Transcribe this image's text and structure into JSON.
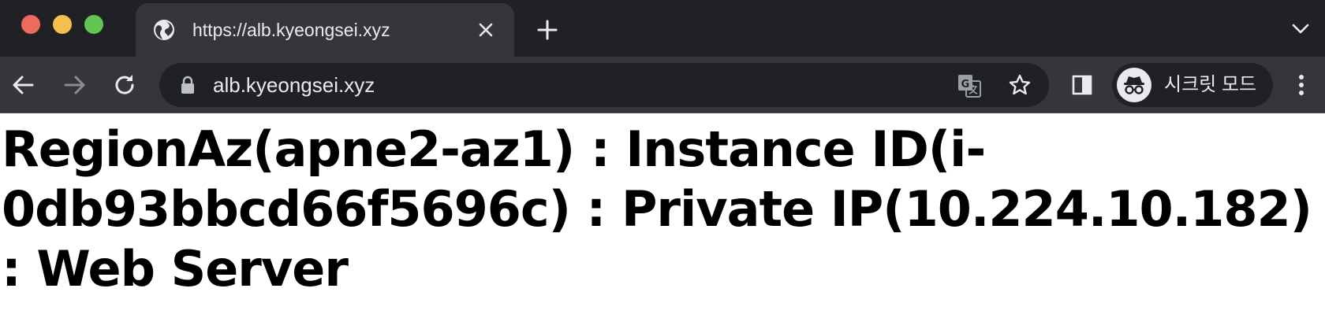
{
  "tab": {
    "title": "https://alb.kyeongsei.xyz",
    "favicon": "globe-icon"
  },
  "omnibox": {
    "url": "alb.kyeongsei.xyz"
  },
  "incognito": {
    "label": "시크릿 모드"
  },
  "page": {
    "heading": "RegionAz(apne2-az1) : Instance ID(i-0db93bbcd66f5696c) : Private IP(10.224.10.182) : Web Server"
  },
  "colors": {
    "chrome_dark": "#202124",
    "chrome_toolbar": "#35363a",
    "text_light": "#e8eaed",
    "close_red": "#ed6a5e",
    "minimize_yellow": "#f5bf4f",
    "zoom_green": "#61c554"
  }
}
